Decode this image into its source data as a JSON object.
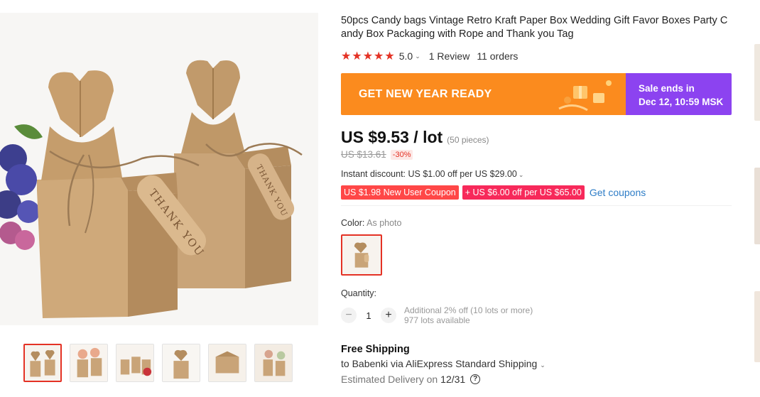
{
  "product": {
    "title": "50pcs Candy bags Vintage Retro Kraft Paper Box Wedding Gift Favor Boxes Party Candy Box Packaging with Rope and Thank you Tag",
    "stars": "★★★★★",
    "rating": "5.0",
    "reviews": "1 Review",
    "orders": "11 orders"
  },
  "image": {
    "tag_text": "THANK YOU"
  },
  "banner": {
    "text": "GET NEW YEAR READY",
    "sale_line1": "Sale ends in",
    "sale_line2": "Dec 12, 10:59 MSK",
    "left_color": "#fb8b1e",
    "right_color": "#8c43f0"
  },
  "price": {
    "current": "US $9.53 / lot",
    "pieces": "(50 pieces)",
    "original": "US $13.61",
    "discount": "-30%"
  },
  "discounts": {
    "instant": "Instant discount: US $1.00 off per US $29.00",
    "coupon_new_user": "US $1.98 New User Coupon",
    "coupon_off": "+ US $6.00 off per US $65.00",
    "get_coupons": "Get coupons"
  },
  "color": {
    "label": "Color:",
    "value": "As photo"
  },
  "quantity": {
    "label": "Quantity:",
    "value": "1",
    "minus": "−",
    "plus": "+",
    "note1": "Additional 2% off (10 lots or more)",
    "note2": "977 lots available"
  },
  "shipping": {
    "title": "Free Shipping",
    "to": "to Babenki via AliExpress Standard Shipping",
    "delivery_label": "Estimated Delivery on",
    "delivery_date": "12/31"
  },
  "icons": {
    "caret": "⌄",
    "help": "?"
  },
  "accent_color": "#e43225"
}
